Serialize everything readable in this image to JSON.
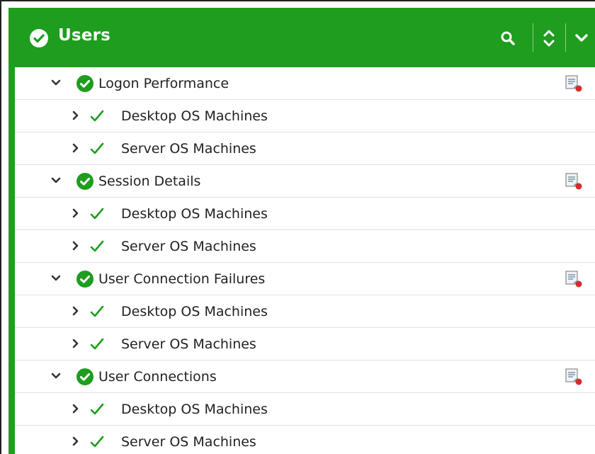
{
  "header": {
    "title": "Users",
    "accent_color": "#1e9d1e",
    "icons": {
      "status": "check-circle-icon",
      "search": "search-icon",
      "sort": "sort-icon",
      "collapse": "chevron-down-icon"
    }
  },
  "groups": [
    {
      "label": "Logon Performance",
      "children": [
        "Desktop OS Machines",
        "Server OS Machines"
      ]
    },
    {
      "label": "Session Details",
      "children": [
        "Desktop OS Machines",
        "Server OS Machines"
      ]
    },
    {
      "label": "User Connection Failures",
      "children": [
        "Desktop OS Machines",
        "Server OS Machines"
      ]
    },
    {
      "label": "User Connections",
      "children": [
        "Desktop OS Machines",
        "Server OS Machines"
      ]
    }
  ],
  "status_color": "#1e9d1e"
}
